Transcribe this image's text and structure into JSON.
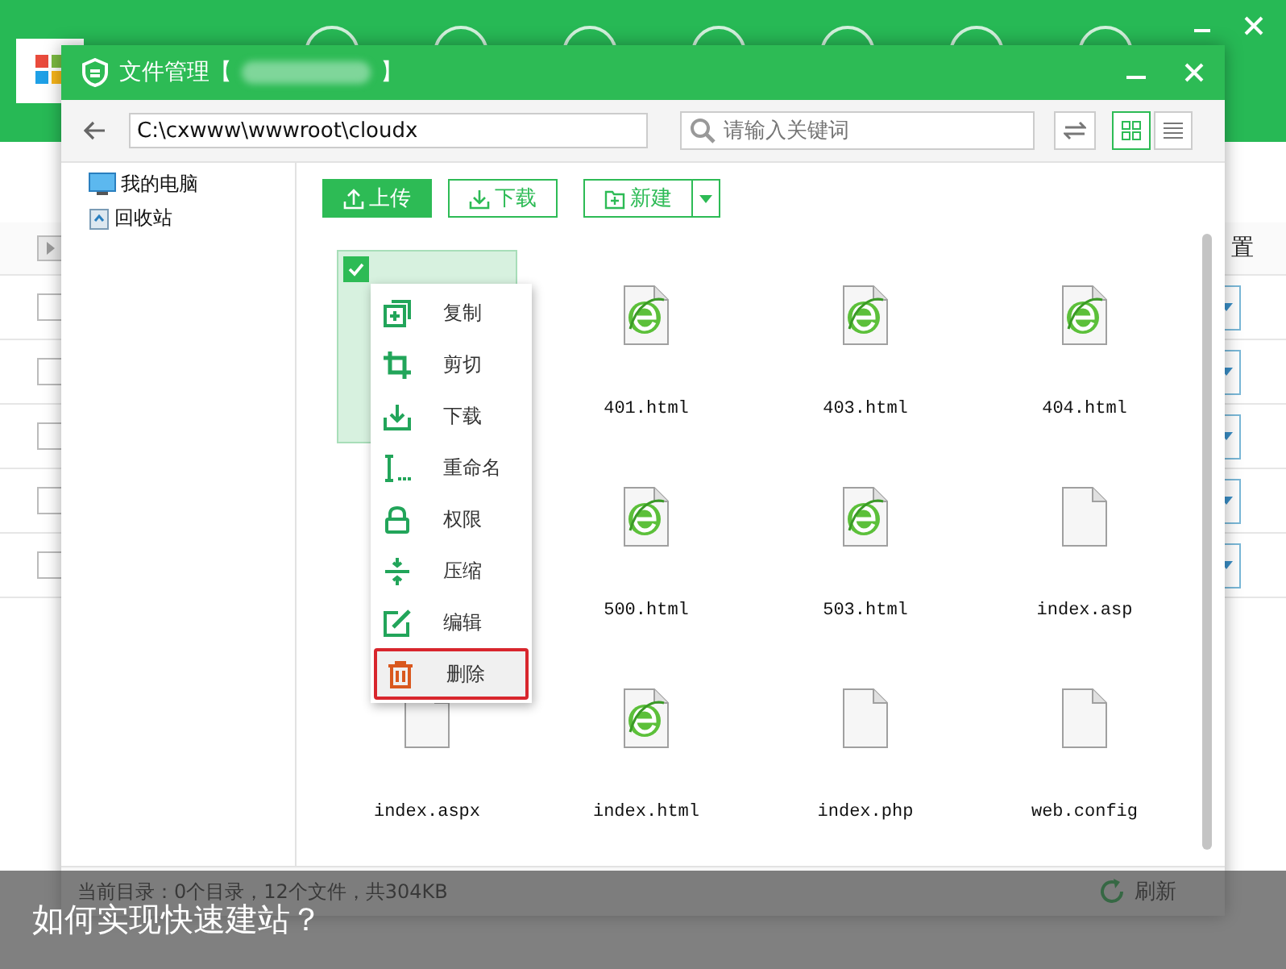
{
  "background_app": {
    "header_column": "置",
    "rows": [
      {
        "checked": false
      },
      {
        "checked": false
      },
      {
        "checked": false
      },
      {
        "checked": false
      },
      {
        "checked": false
      }
    ]
  },
  "window": {
    "title_prefix": "文件管理【",
    "title_suffix": "】"
  },
  "toolbar": {
    "path": "C:\\cxwww\\wwwroot\\cloudx",
    "search": {
      "placeholder": "请输入关键词"
    },
    "views": [
      {
        "kind": "grid",
        "selected": true
      },
      {
        "kind": "list",
        "selected": false
      }
    ]
  },
  "sidebar": {
    "items": [
      {
        "label": "我的电脑",
        "kind": "computer"
      },
      {
        "label": "回收站",
        "kind": "recycle"
      }
    ]
  },
  "actions": [
    {
      "label": "上传",
      "kind": "upload"
    },
    {
      "label": "下载",
      "kind": "download"
    },
    {
      "label": "新建",
      "kind": "new"
    }
  ],
  "files": [
    {
      "kind": "covered",
      "selected": true
    },
    {
      "name": "401.html",
      "kind": "html",
      "selected": false
    },
    {
      "name": "403.html",
      "kind": "html",
      "selected": false
    },
    {
      "name": "404.html",
      "kind": "html",
      "selected": false
    },
    {
      "kind": "covered"
    },
    {
      "name": "500.html",
      "kind": "html",
      "selected": false
    },
    {
      "name": "503.html",
      "kind": "html",
      "selected": false
    },
    {
      "name": "index.asp",
      "kind": "blank",
      "selected": false
    },
    {
      "name": "index.aspx",
      "kind": "blank",
      "selected": false
    },
    {
      "name": "index.html",
      "kind": "html",
      "selected": false
    },
    {
      "name": "index.php",
      "kind": "blank",
      "selected": false
    },
    {
      "name": "web.config",
      "kind": "blank",
      "selected": false
    }
  ],
  "context_menu": [
    {
      "label": "复制",
      "kind": "copy",
      "selected": false
    },
    {
      "label": "剪切",
      "kind": "cut",
      "selected": false
    },
    {
      "label": "下载",
      "kind": "download",
      "selected": false
    },
    {
      "label": "重命名",
      "kind": "rename",
      "selected": false
    },
    {
      "label": "权限",
      "kind": "lock",
      "selected": false
    },
    {
      "label": "压缩",
      "kind": "compress",
      "selected": false
    },
    {
      "label": "编辑",
      "kind": "edit",
      "selected": false
    },
    {
      "label": "删除",
      "kind": "delete",
      "selected": true
    }
  ],
  "status_bar": {
    "summary": "当前目录：0个目录，12个文件，共304KB",
    "refresh": "刷新"
  },
  "caption": "如何实现快速建站？"
}
